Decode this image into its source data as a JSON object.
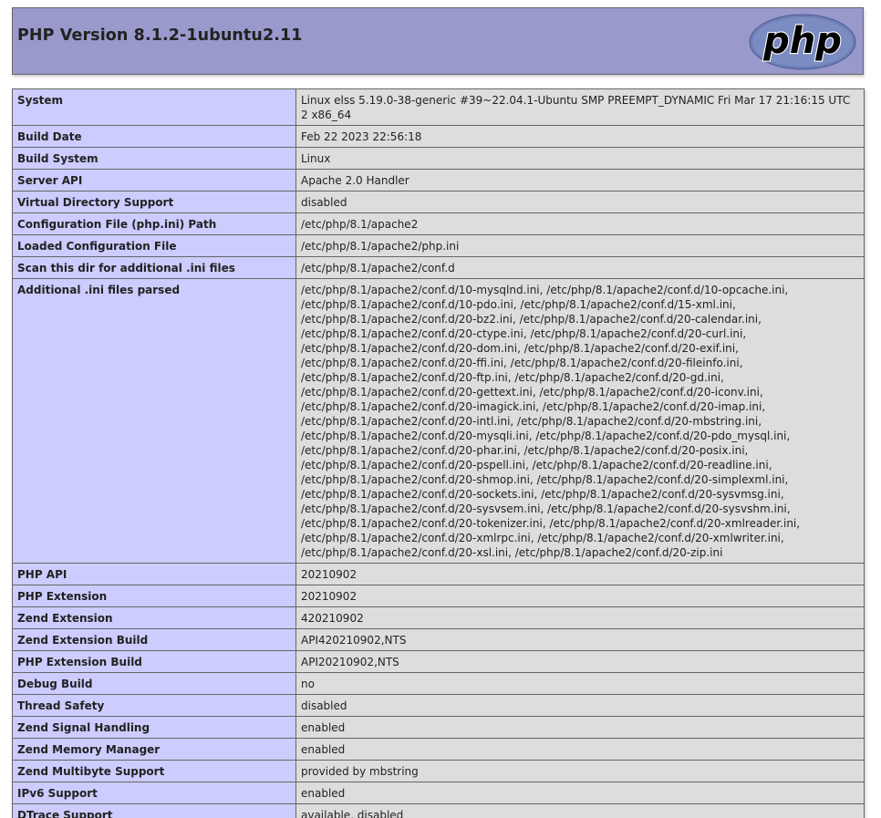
{
  "header": {
    "title": "PHP Version 8.1.2-1ubuntu2.11",
    "logo_text": "php"
  },
  "rows": [
    {
      "label": "System",
      "value": "Linux elss 5.19.0-38-generic #39~22.04.1-Ubuntu SMP PREEMPT_DYNAMIC Fri Mar 17 21:16:15 UTC 2 x86_64"
    },
    {
      "label": "Build Date",
      "value": "Feb 22 2023 22:56:18"
    },
    {
      "label": "Build System",
      "value": "Linux"
    },
    {
      "label": "Server API",
      "value": "Apache 2.0 Handler"
    },
    {
      "label": "Virtual Directory Support",
      "value": "disabled"
    },
    {
      "label": "Configuration File (php.ini) Path",
      "value": "/etc/php/8.1/apache2"
    },
    {
      "label": "Loaded Configuration File",
      "value": "/etc/php/8.1/apache2/php.ini"
    },
    {
      "label": "Scan this dir for additional .ini files",
      "value": "/etc/php/8.1/apache2/conf.d"
    },
    {
      "label": "Additional .ini files parsed",
      "value": "/etc/php/8.1/apache2/conf.d/10-mysqlnd.ini, /etc/php/8.1/apache2/conf.d/10-opcache.ini, /etc/php/8.1/apache2/conf.d/10-pdo.ini, /etc/php/8.1/apache2/conf.d/15-xml.ini, /etc/php/8.1/apache2/conf.d/20-bz2.ini, /etc/php/8.1/apache2/conf.d/20-calendar.ini, /etc/php/8.1/apache2/conf.d/20-ctype.ini, /etc/php/8.1/apache2/conf.d/20-curl.ini, /etc/php/8.1/apache2/conf.d/20-dom.ini, /etc/php/8.1/apache2/conf.d/20-exif.ini, /etc/php/8.1/apache2/conf.d/20-ffi.ini, /etc/php/8.1/apache2/conf.d/20-fileinfo.ini, /etc/php/8.1/apache2/conf.d/20-ftp.ini, /etc/php/8.1/apache2/conf.d/20-gd.ini, /etc/php/8.1/apache2/conf.d/20-gettext.ini, /etc/php/8.1/apache2/conf.d/20-iconv.ini, /etc/php/8.1/apache2/conf.d/20-imagick.ini, /etc/php/8.1/apache2/conf.d/20-imap.ini, /etc/php/8.1/apache2/conf.d/20-intl.ini, /etc/php/8.1/apache2/conf.d/20-mbstring.ini, /etc/php/8.1/apache2/conf.d/20-mysqli.ini, /etc/php/8.1/apache2/conf.d/20-pdo_mysql.ini, /etc/php/8.1/apache2/conf.d/20-phar.ini, /etc/php/8.1/apache2/conf.d/20-posix.ini, /etc/php/8.1/apache2/conf.d/20-pspell.ini, /etc/php/8.1/apache2/conf.d/20-readline.ini, /etc/php/8.1/apache2/conf.d/20-shmop.ini, /etc/php/8.1/apache2/conf.d/20-simplexml.ini, /etc/php/8.1/apache2/conf.d/20-sockets.ini, /etc/php/8.1/apache2/conf.d/20-sysvmsg.ini, /etc/php/8.1/apache2/conf.d/20-sysvsem.ini, /etc/php/8.1/apache2/conf.d/20-sysvshm.ini, /etc/php/8.1/apache2/conf.d/20-tokenizer.ini, /etc/php/8.1/apache2/conf.d/20-xmlreader.ini, /etc/php/8.1/apache2/conf.d/20-xmlrpc.ini, /etc/php/8.1/apache2/conf.d/20-xmlwriter.ini, /etc/php/8.1/apache2/conf.d/20-xsl.ini, /etc/php/8.1/apache2/conf.d/20-zip.ini"
    },
    {
      "label": "PHP API",
      "value": "20210902"
    },
    {
      "label": "PHP Extension",
      "value": "20210902"
    },
    {
      "label": "Zend Extension",
      "value": "420210902"
    },
    {
      "label": "Zend Extension Build",
      "value": "API420210902,NTS"
    },
    {
      "label": "PHP Extension Build",
      "value": "API20210902,NTS"
    },
    {
      "label": "Debug Build",
      "value": "no"
    },
    {
      "label": "Thread Safety",
      "value": "disabled"
    },
    {
      "label": "Zend Signal Handling",
      "value": "enabled"
    },
    {
      "label": "Zend Memory Manager",
      "value": "enabled"
    },
    {
      "label": "Zend Multibyte Support",
      "value": "provided by mbstring"
    },
    {
      "label": "IPv6 Support",
      "value": "enabled"
    },
    {
      "label": "DTrace Support",
      "value": "available, disabled"
    }
  ]
}
